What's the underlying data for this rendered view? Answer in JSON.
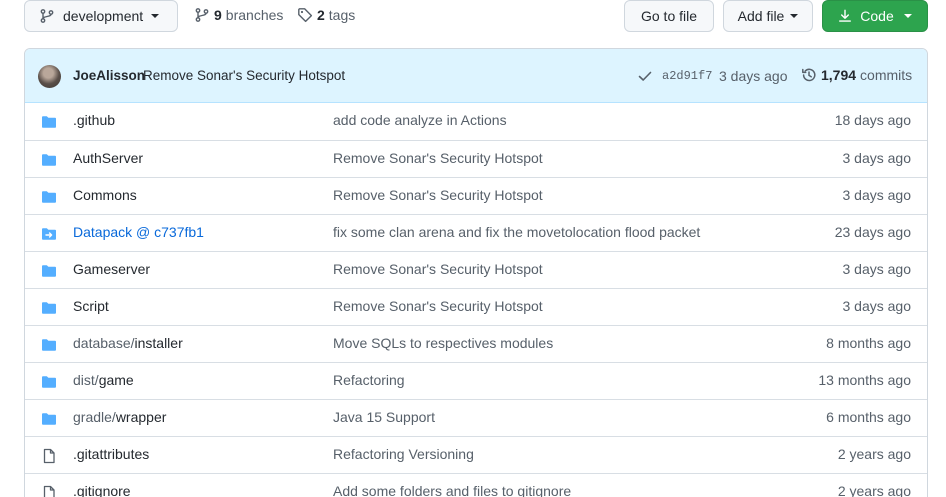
{
  "toolbar": {
    "branch": "development",
    "branches_count": "9",
    "branches_label": "branches",
    "tags_count": "2",
    "tags_label": "tags",
    "goto_file": "Go to file",
    "add_file": "Add file",
    "code": "Code"
  },
  "latest_commit": {
    "author": "JoeAlisson",
    "message": "Remove Sonar's Security Hotspot",
    "sha": "a2d91f7",
    "time": "3 days ago",
    "commits_count": "1,794",
    "commits_label": "commits"
  },
  "files": [
    {
      "dim": "",
      "name": ".github",
      "type": "folder",
      "message": "add code analyze in Actions",
      "age": "18 days ago"
    },
    {
      "dim": "",
      "name": "AuthServer",
      "type": "folder",
      "message": "Remove Sonar's Security Hotspot",
      "age": "3 days ago"
    },
    {
      "dim": "",
      "name": "Commons",
      "type": "folder",
      "message": "Remove Sonar's Security Hotspot",
      "age": "3 days ago"
    },
    {
      "dim": "",
      "name": "Datapack @ c737fb1",
      "type": "submodule",
      "message": "fix some clan arena and fix the movetolocation flood packet",
      "age": "23 days ago"
    },
    {
      "dim": "",
      "name": "Gameserver",
      "type": "folder",
      "message": "Remove Sonar's Security Hotspot",
      "age": "3 days ago"
    },
    {
      "dim": "",
      "name": "Script",
      "type": "folder",
      "message": "Remove Sonar's Security Hotspot",
      "age": "3 days ago"
    },
    {
      "dim": "database/",
      "name": "installer",
      "type": "folder",
      "message": "Move SQLs to respectives modules",
      "age": "8 months ago"
    },
    {
      "dim": "dist/",
      "name": "game",
      "type": "folder",
      "message": "Refactoring",
      "age": "13 months ago"
    },
    {
      "dim": "gradle/",
      "name": "wrapper",
      "type": "folder",
      "message": "Java 15 Support",
      "age": "6 months ago"
    },
    {
      "dim": "",
      "name": ".gitattributes",
      "type": "file",
      "message": "Refactoring Versioning",
      "age": "2 years ago"
    },
    {
      "dim": "",
      "name": ".gitignore",
      "type": "file",
      "message": "Add some folders and files to gitignore",
      "age": "2 years ago"
    }
  ],
  "colors": {
    "folder": "#54aeff",
    "file": "#57606a",
    "link": "#0969da",
    "primary": "#2da44e",
    "commit_bar": "#ddf4ff"
  }
}
